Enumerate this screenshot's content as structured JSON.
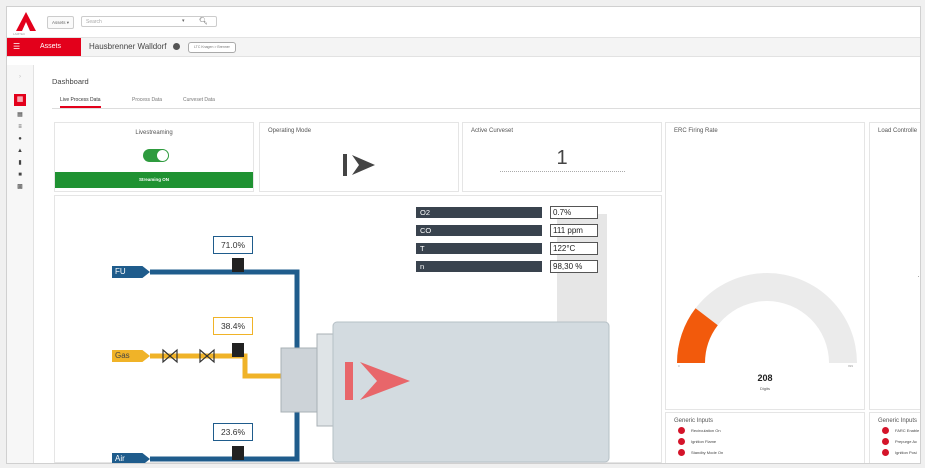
{
  "header": {
    "logo_text": "LAMTEC",
    "assets_dropdown": "Assets",
    "search_placeholder": "Search",
    "search_caret": "▾"
  },
  "subbar": {
    "assets_label": "Assets",
    "asset_title": "Hausbrenner Walldorf",
    "asset_path": "LTC Knagen > Brenner"
  },
  "page": {
    "title": "Dashboard",
    "tabs": [
      {
        "label": "Live Process Data",
        "active": true
      },
      {
        "label": "Process Data",
        "active": false
      },
      {
        "label": "Curveset Data",
        "active": false
      }
    ]
  },
  "cards": {
    "livestreaming": {
      "title": "Livestreaming",
      "status": "Streaming ON",
      "enabled": true
    },
    "operating_mode": {
      "title": "Operating Mode"
    },
    "active_curveset": {
      "title": "Active Curveset",
      "value": "1"
    },
    "erc_firing_rate": {
      "title": "ERC Firing Rate",
      "value": "208",
      "unit": "Digits",
      "min": "0",
      "max": "999",
      "gauge_fraction": 0.208
    },
    "load_controller": {
      "title": "Load Controlle"
    }
  },
  "process": {
    "readouts": [
      {
        "label": "O2",
        "value": "0.7%"
      },
      {
        "label": "CO",
        "value": "111 ppm"
      },
      {
        "label": "T",
        "value": "122°C"
      },
      {
        "label": "n",
        "value": "98,30 %"
      }
    ],
    "lines": [
      {
        "label": "FU",
        "percent": "71.0%",
        "color": "#1f5c8c"
      },
      {
        "label": "Gas",
        "percent": "38.4%",
        "color": "#f0b328"
      },
      {
        "label": "Air",
        "percent": "23.6%",
        "color": "#1f5c8c"
      }
    ]
  },
  "generic_inputs": {
    "title": "Generic Inputs",
    "items": [
      "Recirculation On",
      "Ignition Flame",
      "Standby Mode On"
    ]
  },
  "generic_inputs_2": {
    "title": "Generic Inputs",
    "items": [
      "FARC Enable",
      "Prepurge Ac",
      "Ignition Posi"
    ]
  },
  "colors": {
    "brand_red": "#e3001b",
    "stream_green": "#1f9232",
    "gauge_orange": "#f25a0c",
    "indicator_red": "#d4142a",
    "pipe_blue": "#1f5c8c",
    "pipe_gas": "#f0b328"
  }
}
